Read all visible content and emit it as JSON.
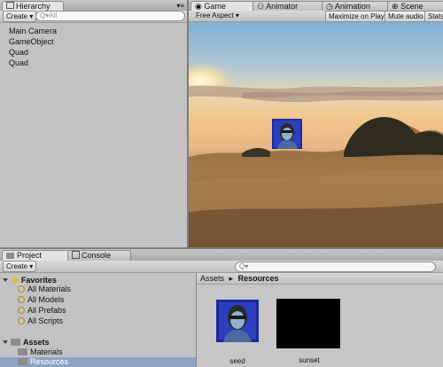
{
  "hierarchy": {
    "tab": "Hierarchy",
    "create": "Create",
    "search_placeholder": "Q▾All",
    "items": [
      "Main Camera",
      "GameObject",
      "Quad",
      "Quad"
    ]
  },
  "game": {
    "tabs": [
      "Game",
      "Animator",
      "Animation",
      "Scene"
    ],
    "aspect": "Free Aspect",
    "maximize": "Maximize on Play",
    "mute": "Mute audio",
    "stats": "Stats"
  },
  "project": {
    "tabs": [
      "Project",
      "Console"
    ],
    "create": "Create",
    "favorites_label": "Favorites",
    "favorites": [
      "All Materials",
      "All Models",
      "All Prefabs",
      "All Scripts"
    ],
    "assets_label": "Assets",
    "asset_folders": [
      "Materials",
      "Resources"
    ],
    "breadcrumb": [
      "Assets",
      "Resources"
    ],
    "files": [
      "seed",
      "sunset"
    ]
  },
  "colors": {
    "accent_tab": "#e3e3e3",
    "selection": "#8fa4c4",
    "favorites_star": "#e8c020"
  }
}
